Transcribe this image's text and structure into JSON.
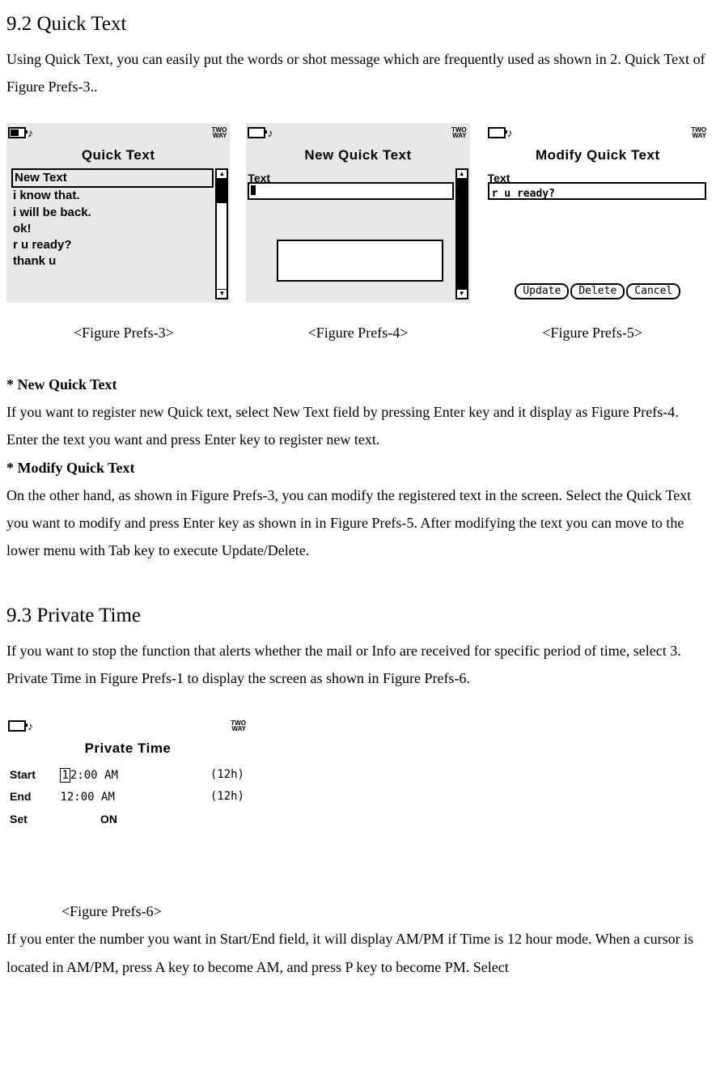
{
  "section92": {
    "heading": "9.2 Quick Text",
    "para1": "Using Quick Text, you can easily put the words or shot message    which are frequently used as shown in 2. Quick Text of Figure Prefs-3.."
  },
  "screen1": {
    "title": "Quick Text",
    "items": [
      "New Text",
      "i know that.",
      "i will be back.",
      "ok!",
      "r u ready?",
      "thank u"
    ],
    "status_right": "TWO\nWAY",
    "caption": "<Figure Prefs-3>"
  },
  "screen2": {
    "title": "New Quick Text",
    "field_label": "Text",
    "status_right": "TWO\nWAY",
    "caption": "<Figure Prefs-4>"
  },
  "screen3": {
    "title": "Modify Quick Text",
    "field_label": "Text",
    "input_value": "r u ready?",
    "buttons": [
      "Update",
      "Delete",
      "Cancel"
    ],
    "status_right": "TWO\nWAY",
    "caption": "<Figure Prefs-5>"
  },
  "newqt": {
    "heading": "* New Quick Text",
    "text": "If you want to register new Quick text, select New Text field by pressing    Enter key and it display as Figure Prefs-4.        Enter the text you want and press Enter key to register new text."
  },
  "modqt": {
    "heading": "* Modify Quick Text",
    "text": "On the other hand, as shown in Figure Prefs-3, you can modify the registered text in the screen. Select the Quick Text you want to modify and press Enter key as shown in in Figure Prefs-5. After modifying the text you can move to the lower menu with Tab key to execute Update/Delete."
  },
  "section93": {
    "heading": "9.3 Private Time",
    "para1": "If you want to stop the function that alerts whether the mail or Info are received for specific period of time, select 3. Private Time in Figure Prefs-1 to display the screen as shown in Figure Prefs-6."
  },
  "screen4": {
    "title": "Private Time",
    "rows": [
      {
        "label": "Start",
        "time": "12:00 AM",
        "mode": "(12h)"
      },
      {
        "label": "End",
        "time": "12:00 AM",
        "mode": "(12h)"
      },
      {
        "label": "Set",
        "value": "ON"
      }
    ],
    "status_right": "TWO\nWAY",
    "caption": "<Figure Prefs-6>"
  },
  "para_after_fig6": "If you enter the number you want in Start/End field, it will display AM/PM if Time is 12 hour mode. When a cursor is located in AM/PM, press A key to become AM, and press P key to become PM. Select"
}
